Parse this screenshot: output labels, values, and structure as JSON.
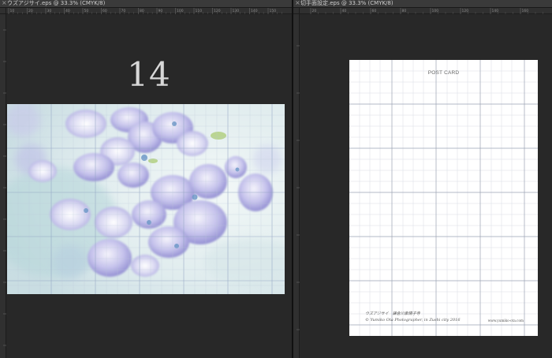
{
  "left_document": {
    "tab_title": "ウズアジサイ.eps @ 33.3% (CMYK/8)",
    "close_label": "×",
    "ruler_labels": [
      "10",
      "20",
      "30",
      "40",
      "50",
      "60",
      "70",
      "80",
      "90",
      "100",
      "110",
      "120",
      "130",
      "140",
      "150"
    ],
    "page_number": "14"
  },
  "right_document": {
    "tab_title": "切手面設定.eps @ 33.3% (CMYK/8)",
    "close_label": "×",
    "ruler_labels": [
      "20",
      "40",
      "60",
      "80",
      "100",
      "120",
      "140",
      "160"
    ],
    "postcard": {
      "title": "POST CARD",
      "caption_line1": "ウズアジサイ　鎌倉川紫陽子寺",
      "caption_line2": "© Yumiko Ota Photographer, in Zushi city 2016",
      "url": "www.yumiko-ota.com"
    }
  },
  "colors": {
    "workspace": "#282828",
    "tab_bg": "#3a3a3a",
    "guide": "#8ea0c0",
    "flower_violet": "#9a96d8"
  }
}
